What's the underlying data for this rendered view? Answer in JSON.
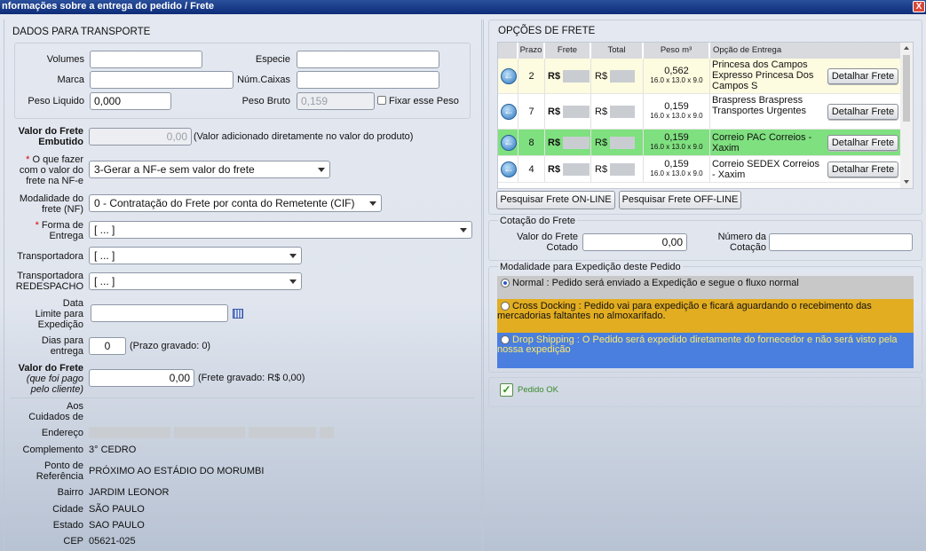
{
  "window": {
    "title": "nformações sobre a entrega do pedido / Frete",
    "close_label": "X"
  },
  "transporte": {
    "title": "DADOS PARA TRANSPORTE",
    "volumes_label": "Volumes",
    "volumes_value": "",
    "especie_label": "Especie",
    "especie_value": "",
    "marca_label": "Marca",
    "marca_value": "",
    "num_caixas_label": "Núm.Caixas",
    "num_caixas_value": "",
    "peso_liquido_label": "Peso Liquido",
    "peso_liquido_value": "0,000",
    "peso_bruto_label": "Peso Bruto",
    "peso_bruto_value": "0,159",
    "fixar_peso_label": "Fixar esse Peso",
    "valor_frete_embutido_label": "Valor do Frete Embutido",
    "valor_frete_embutido_value": "0,00",
    "valor_frete_embutido_note": "(Valor adicionado diretamente no valor do produto)",
    "o_que_fazer_label": "O que fazer com o valor do frete na NF-e",
    "o_que_fazer_value": "3-Gerar a NF-e sem valor do frete",
    "modalidade_label": "Modalidade do frete (NF)",
    "modalidade_value": "0 - Contratação do Frete por conta do Remetente (CIF)",
    "forma_entrega_label": "Forma de Entrega",
    "forma_entrega_value": "[ ... ]",
    "transportadora_label": "Transportadora",
    "transportadora_value": "[ ... ]",
    "redespacho_label": "Transportadora REDESPACHO",
    "redespacho_value": "[ ... ]",
    "data_limite_label": "Data Limite para Expedição",
    "data_limite_value": "",
    "dias_label": "Dias para entrega",
    "dias_value": "0",
    "dias_note": "(Prazo gravado: 0)",
    "valor_frete_pago_label": "Valor do Frete",
    "valor_frete_pago_sub": "(que foi pago pelo cliente)",
    "valor_frete_pago_value": "0,00",
    "valor_frete_pago_note": "(Frete gravado: R$ 0,00)",
    "required_mark": "*"
  },
  "endereco": {
    "aos_cuidados_label": "Aos Cuidados de",
    "aos_cuidados_value": "",
    "endereco_label": "Endereço",
    "complemento_label": "Complemento",
    "complemento_value": "3° CEDRO",
    "ponto_ref_label": "Ponto de Referência",
    "ponto_ref_value": "PRÓXIMO AO ESTÁDIO DO MORUMBI",
    "bairro_label": "Bairro",
    "bairro_value": "JARDIM LEONOR",
    "cidade_label": "Cidade",
    "cidade_value": "SÃO PAULO",
    "estado_label": "Estado",
    "estado_value": "SAO PAULO",
    "cep_label": "CEP",
    "cep_value": "05621-025"
  },
  "opcoes": {
    "title": "OPÇÕES DE FRETE",
    "headers": {
      "prazo": "Prazo",
      "frete": "Frete",
      "total": "Total",
      "peso": "Peso m³",
      "opcao": "Opção de Entrega"
    },
    "currency": "R$",
    "detalhar_label": "Detalhar Frete",
    "rows": [
      {
        "prazo": "2",
        "peso": "0,562",
        "dims": "16.0 x 13.0 x 9.0",
        "opcao": "Princesa dos Campos Expresso Princesa Dos Campos S",
        "bg": "#fdfbe0"
      },
      {
        "prazo": "7",
        "peso": "0,159",
        "dims": "16.0 x 13.0 x 9.0",
        "opcao": "Braspress Braspress Transportes Urgentes",
        "bg": "#ffffff"
      },
      {
        "prazo": "8",
        "peso": "0,159",
        "dims": "16.0 x 13.0 x 9.0",
        "opcao": "Correio PAC Correios - Xaxim",
        "bg": "#7fe07f"
      },
      {
        "prazo": "4",
        "peso": "0,159",
        "dims": "16.0 x 13.0 x 9.0",
        "opcao": "Correio SEDEX Correios - Xaxim",
        "bg": "#ffffff"
      }
    ],
    "btn_online": "Pesquisar Frete ON-LINE",
    "btn_offline": "Pesquisar Frete OFF-LINE"
  },
  "cotacao": {
    "title": "Cotação do Frete",
    "valor_label": "Valor do Frete Cotado",
    "valor_value": "0,00",
    "numero_label": "Número da Cotação",
    "numero_value": ""
  },
  "modalidade_exp": {
    "title": "Modalidade para Expedição deste Pedido",
    "options": [
      {
        "text": "Normal : Pedido será enviado a Expedição e segue o fluxo normal",
        "selected": true,
        "bg": "#c8c8c8",
        "color": "#111111"
      },
      {
        "text": "Cross Docking : Pedido vai para expedição e ficará aguardando o recebimento das mercadorias faltantes no almoxarifado.",
        "selected": false,
        "bg": "#e2ad20",
        "color": "#111111"
      },
      {
        "text": "Drop Shipping : O Pedido será expedido diretamente do fornecedor e não será visto pela nossa expedição",
        "selected": false,
        "bg": "#4a7fe0",
        "color": "#ffe96a"
      }
    ]
  },
  "pedido_ok": {
    "label": "Pedido OK",
    "color": "#3a8a2a"
  }
}
